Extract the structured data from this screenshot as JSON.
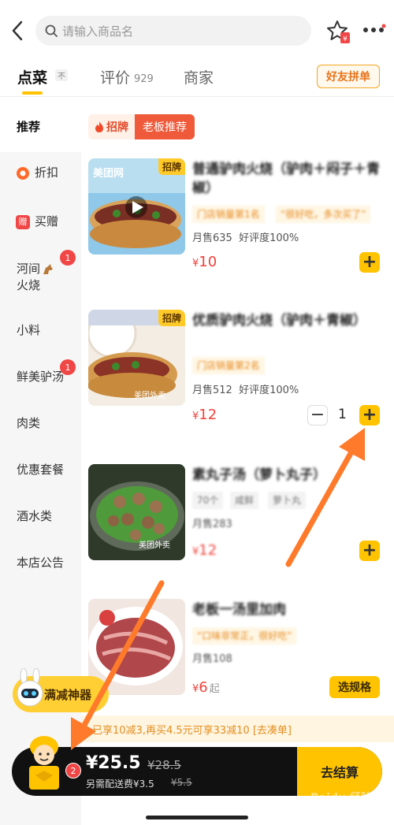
{
  "header": {
    "search_placeholder": "请输入商品名"
  },
  "tabs": {
    "order": "点菜",
    "order_sup": "不",
    "review": "评价",
    "review_count": "929",
    "merchant": "商家",
    "group_order": "好友拼单"
  },
  "sidebar": {
    "items": [
      {
        "label": "推荐"
      },
      {
        "label": "折扣"
      },
      {
        "label": "买赠"
      },
      {
        "label": "河间",
        "label2": "火烧",
        "badge": "1"
      },
      {
        "label": "小料"
      },
      {
        "label": "鲜美驴汤",
        "badge": "1"
      },
      {
        "label": "肉类"
      },
      {
        "label": "优惠套餐"
      },
      {
        "label": "酒水类"
      },
      {
        "label": "本店公告"
      }
    ],
    "gift_icon_text": "赠"
  },
  "promo": {
    "left": "招牌",
    "right": "老板推荐"
  },
  "dishes": [
    {
      "name": "普通驴肉火烧（驴肉＋闷子＋青椒）",
      "tag1": "门店销量第1名",
      "tag2": "“很好吃，多次买了”",
      "sales": "月售635",
      "rating": "好评度100%",
      "currency": "¥",
      "price": "10",
      "signature": "招牌",
      "watermark": "美团网"
    },
    {
      "name": "优质驴肉火烧（驴肉＋青椒）",
      "tag1": "门店销量第2名",
      "sales": "月售512",
      "rating": "好评度100%",
      "currency": "¥",
      "price": "12",
      "qty": "1",
      "signature": "招牌",
      "watermark": "美团外卖"
    },
    {
      "name": "素丸子汤（萝卜丸子）",
      "tag1": "70个",
      "tag2": "咸鲜",
      "tag3": "萝卜丸",
      "sales": "月售283",
      "currency": "¥",
      "price": "12",
      "watermark": "美团外卖"
    },
    {
      "name": "老板一汤里加肉",
      "tag1": "“口味非常正，很好吃”",
      "sales": "月售108",
      "currency": "¥",
      "price": "6",
      "price_suffix": "起",
      "spec": "选规格"
    }
  ],
  "bottom": {
    "tool": "满减神器",
    "promo_text": "已享10减3,再买4.5元可享33减10 [去凑单]",
    "total": "¥25.5",
    "orig_total": "¥28.5",
    "shipping": "另需配送费¥3.5",
    "shipping_orig": "¥5.5",
    "checkout": "去结算",
    "cart_count": "2",
    "watermark": "Baidu 经验"
  },
  "colors": {
    "accent": "#ffc300",
    "price": "#f0423a",
    "annotation_arrow": "#ff7a2a"
  }
}
